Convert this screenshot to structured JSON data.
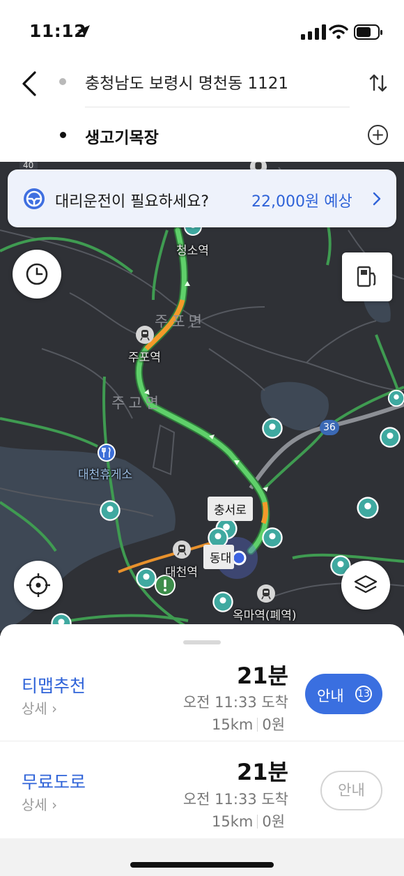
{
  "status_bar": {
    "time": "11:12"
  },
  "route_header": {
    "origin": "충청남도 보령시 명천동 1121",
    "destination": "생고기목장"
  },
  "daeri_banner": {
    "text": "대리운전이 필요하세요?",
    "price": "22,000원 예상"
  },
  "map": {
    "labels": {
      "cheongso": "청소역",
      "jupo_station": "주포역",
      "jupo_myeon": "주포면",
      "jugyo_myeon": "주고면",
      "daecheon_rest": "대천휴게소",
      "chungseoro": "충서로",
      "dongdae": "동대",
      "daecheon_station": "대천역",
      "okma": "옥마역(폐역)",
      "road_36": "36",
      "road_40": "40"
    }
  },
  "routes": [
    {
      "name": "티맵추천",
      "detail": "상세",
      "duration": "21분",
      "arrival": "오전 11:33 도착",
      "distance": "15km",
      "toll": "0원",
      "guide_label": "안내",
      "guide_badge": "13"
    },
    {
      "name": "무료도로",
      "detail": "상세",
      "duration": "21분",
      "arrival": "오전 11:33 도착",
      "distance": "15km",
      "toll": "0원",
      "guide_label": "안내"
    }
  ],
  "colors": {
    "accent": "#3a6fe0",
    "route_green": "#4cc05a",
    "route_orange": "#f39a2a",
    "map_bg": "#2f3136",
    "poi_teal": "#3fa9a0"
  },
  "icons": [
    "location-arrow-icon",
    "signal-icon",
    "wifi-icon",
    "battery-icon",
    "back-icon",
    "swap-icon",
    "add-circle-icon",
    "steering-wheel-icon",
    "chevron-right-icon",
    "clock-icon",
    "gas-station-icon",
    "locate-icon",
    "layers-icon",
    "train-icon",
    "restaurant-icon",
    "poi-pin-icon",
    "warning-icon"
  ]
}
